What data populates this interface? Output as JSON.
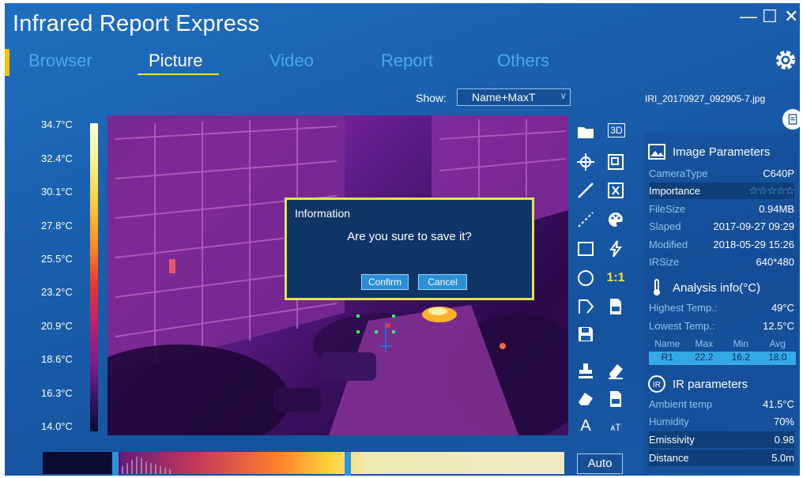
{
  "app": {
    "title": "Infrared Report Express"
  },
  "window_controls": {
    "minimize": "—",
    "maximize": "☐",
    "close": "✕"
  },
  "nav": {
    "tabs": [
      {
        "label": "Browser"
      },
      {
        "label": "Picture"
      },
      {
        "label": "Video"
      },
      {
        "label": "Report"
      },
      {
        "label": "Others"
      }
    ],
    "active": "Picture"
  },
  "toolbar": {
    "show_label": "Show:",
    "show_value": "Name+MaxT"
  },
  "scale": {
    "labels": [
      "34.7°C",
      "32.4°C",
      "30.1°C",
      "27.8°C",
      "25.5°C",
      "23.2°C",
      "20.9°C",
      "18.6°C",
      "16.3°C",
      "14.0°C"
    ]
  },
  "dialog": {
    "title": "Information",
    "message": "Are you sure to save it?",
    "confirm": "Confirm",
    "cancel": "Cancel"
  },
  "tools": {
    "text_tool": "A",
    "text_size_tool": "ᴀT",
    "three_d": "3D",
    "one_to_one": "1:1"
  },
  "filename": "IRI_20170927_092905-7.jpg",
  "image_params": {
    "title": "Image Parameters",
    "camera_type_label": "CameraType",
    "camera_type_value": "C640P",
    "importance_label": "Importance",
    "importance_stars": "☆☆☆☆☆",
    "filesize_label": "FileSize",
    "filesize_value": "0.94MB",
    "slaped_label": "Slaped",
    "slaped_value": "2017-09-27 09:29",
    "modified_label": "Modified",
    "modified_value": "2018-05-29 15:26",
    "irsize_label": "IRSize",
    "irsize_value": "640*480"
  },
  "analysis": {
    "title": "Analysis info(°C)",
    "highest_label": "Highest Temp.:",
    "highest_value": "49°C",
    "lowest_label": "Lowest Temp.:",
    "lowest_value": "12.5°C",
    "columns": [
      "Name",
      "Max",
      "Min",
      "Avg"
    ],
    "rows": [
      {
        "name": "R1",
        "max": "22.2",
        "min": "16.2",
        "avg": "18.0"
      }
    ]
  },
  "ir_params": {
    "title": "IR parameters",
    "ambient_label": "Ambient temp",
    "ambient_value": "41.5°C",
    "humidity_label": "Humidity",
    "humidity_value": "70%",
    "emissivity_label": "Emissivity",
    "emissivity_value": "0.98",
    "distance_label": "Distance",
    "distance_value": "5.0m"
  },
  "bottom": {
    "auto_label": "Auto"
  },
  "colors": {
    "accent": "#f5c400",
    "dialog_border": "#e6e24a",
    "panel_highlight": "#35a8e8"
  }
}
